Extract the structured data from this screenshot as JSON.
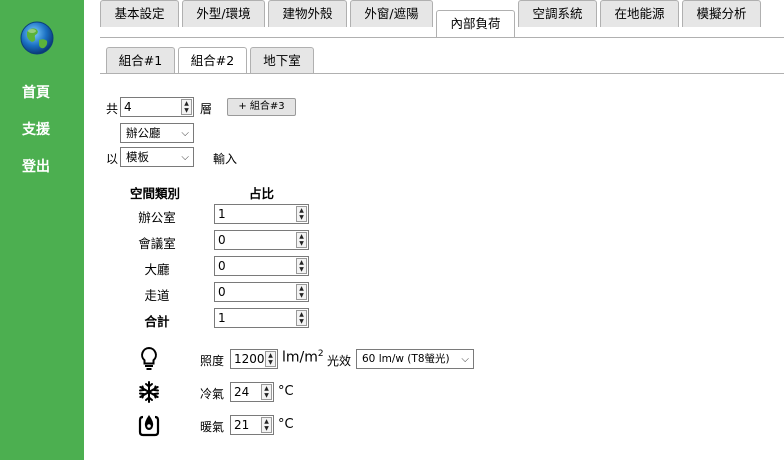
{
  "sidebar": {
    "logo": "globe-icon",
    "links": [
      "首頁",
      "支援",
      "登出"
    ]
  },
  "tabs": [
    "基本設定",
    "外型/環境",
    "建物外殼",
    "外窗/遮陽",
    "內部負荷",
    "空調系統",
    "在地能源",
    "模擬分析"
  ],
  "active_tab": "內部負荷",
  "subtabs": [
    "組合#1",
    "組合#2",
    "地下室"
  ],
  "active_subtab": "組合#2",
  "floors": {
    "prefix": "共",
    "value": "4",
    "suffix": "層",
    "add_button": "+ 組合#3"
  },
  "building_type": "辦公廳",
  "input_mode": {
    "prefix": "以",
    "value": "模板",
    "suffix": "輸入"
  },
  "space_table": {
    "col_type": "空間類別",
    "col_ratio": "占比",
    "rows": [
      {
        "name": "辦公室",
        "value": "1"
      },
      {
        "name": "會議室",
        "value": "0"
      },
      {
        "name": "大廳",
        "value": "0"
      },
      {
        "name": "走道",
        "value": "0"
      }
    ],
    "total_label": "合計",
    "total_value": "1"
  },
  "lighting": {
    "icon": "lightbulb-icon",
    "label": "照度",
    "value": "1200",
    "unit": "lm/m",
    "unit_sup": "2",
    "efficacy_label": "光效",
    "efficacy_value": "60 lm/w (T8螢光)"
  },
  "cooling": {
    "icon": "snowflake-icon",
    "label": "冷氣",
    "value": "24",
    "unit": "°C"
  },
  "heating": {
    "icon": "heater-icon",
    "label": "暖氣",
    "value": "21",
    "unit": "°C"
  },
  "colors": {
    "sidebar": "#4caf50",
    "tab_bg": "#e6e6e6",
    "border": "#b0b0b0"
  }
}
